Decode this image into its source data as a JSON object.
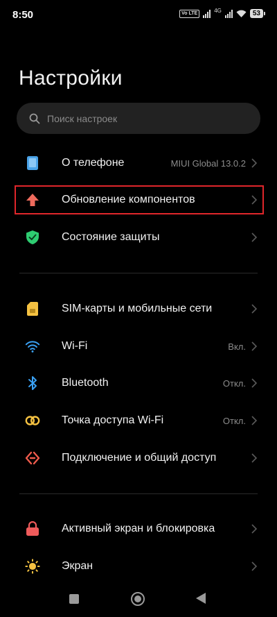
{
  "status_bar": {
    "time": "8:50",
    "volte": "Vo LTE",
    "network": "4G",
    "battery": "53"
  },
  "title": "Настройки",
  "search": {
    "placeholder": "Поиск настроек"
  },
  "items": [
    {
      "label": "О телефоне",
      "value": "MIUI Global 13.0.2",
      "icon": "phone-icon",
      "color": "#4aa3e8"
    },
    {
      "label": "Обновление компонентов",
      "value": "",
      "icon": "arrow-up-icon",
      "color": "#ef6b5d"
    },
    {
      "label": "Состояние защиты",
      "value": "",
      "icon": "shield-check-icon",
      "color": "#2ecc71"
    },
    {
      "label": "SIM-карты и мобильные сети",
      "value": "",
      "icon": "sim-card-icon",
      "color": "#f5c242"
    },
    {
      "label": "Wi-Fi",
      "value": "Вкл.",
      "icon": "wifi-icon",
      "color": "#3aa0f2"
    },
    {
      "label": "Bluetooth",
      "value": "Откл.",
      "icon": "bluetooth-icon",
      "color": "#3aa0f2"
    },
    {
      "label": "Точка доступа Wi-Fi",
      "value": "Откл.",
      "icon": "hotspot-icon",
      "color": "#f5c242"
    },
    {
      "label": "Подключение и общий доступ",
      "value": "",
      "icon": "connection-icon",
      "color": "#ef5b4c"
    },
    {
      "label": "Активный экран и блокировка",
      "value": "",
      "icon": "lock-icon",
      "color": "#ef5b5b"
    },
    {
      "label": "Экран",
      "value": "",
      "icon": "sun-icon",
      "color": "#f5c242"
    }
  ],
  "colors": {
    "background": "#000000",
    "highlight_border": "#e0262b",
    "secondary_text": "#8c8c8c"
  }
}
